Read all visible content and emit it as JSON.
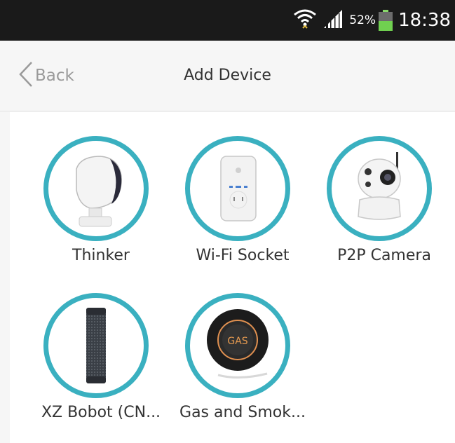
{
  "status_bar": {
    "battery_percent": "52%",
    "time": "18:38"
  },
  "nav": {
    "back_label": "Back",
    "title": "Add Device"
  },
  "devices": [
    {
      "label": "Thinker",
      "icon": "thinker-device-icon"
    },
    {
      "label": "Wi-Fi Socket",
      "icon": "wifi-socket-icon"
    },
    {
      "label": "P2P Camera",
      "icon": "p2p-camera-icon"
    },
    {
      "label": "XZ Bobot (CN...",
      "icon": "xz-bobot-speaker-icon"
    },
    {
      "label": "Gas and Smok...",
      "icon": "gas-smoke-detector-icon",
      "badge": "GAS"
    }
  ],
  "colors": {
    "accent_ring": "#3ab0c0",
    "status_bar_bg": "#1a1a1a",
    "battery_fill": "#70d050",
    "nav_bg": "#f6f6f6"
  }
}
